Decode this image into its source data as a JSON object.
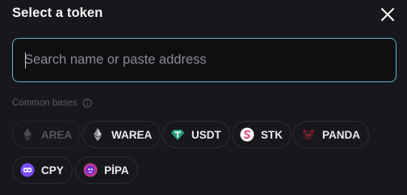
{
  "modal": {
    "title": "Select a token",
    "close_icon": "close-icon"
  },
  "search": {
    "placeholder": "Search name or paste address",
    "value": ""
  },
  "common_bases": {
    "label": "Common bases",
    "info_icon": "info-icon",
    "tokens": [
      {
        "symbol": "AREA",
        "icon": "area-token-icon",
        "disabled": true
      },
      {
        "symbol": "WAREA",
        "icon": "warea-token-icon",
        "disabled": false
      },
      {
        "symbol": "USDT",
        "icon": "usdt-token-icon",
        "disabled": false
      },
      {
        "symbol": "STK",
        "icon": "stk-token-icon",
        "disabled": false
      },
      {
        "symbol": "PANDA",
        "icon": "panda-token-icon",
        "disabled": false
      },
      {
        "symbol": "CPY",
        "icon": "cpy-token-icon",
        "disabled": false
      },
      {
        "symbol": "PİPA",
        "icon": "pipa-token-icon",
        "disabled": false
      }
    ]
  },
  "colors": {
    "background": "#18171b",
    "search_border": "#5fb3dc",
    "chip_border": "#2e2e35",
    "usdt": "#26a17b",
    "stk": "#e8437b",
    "cpy": "#7b4dff",
    "pipa": "#c0398e"
  }
}
